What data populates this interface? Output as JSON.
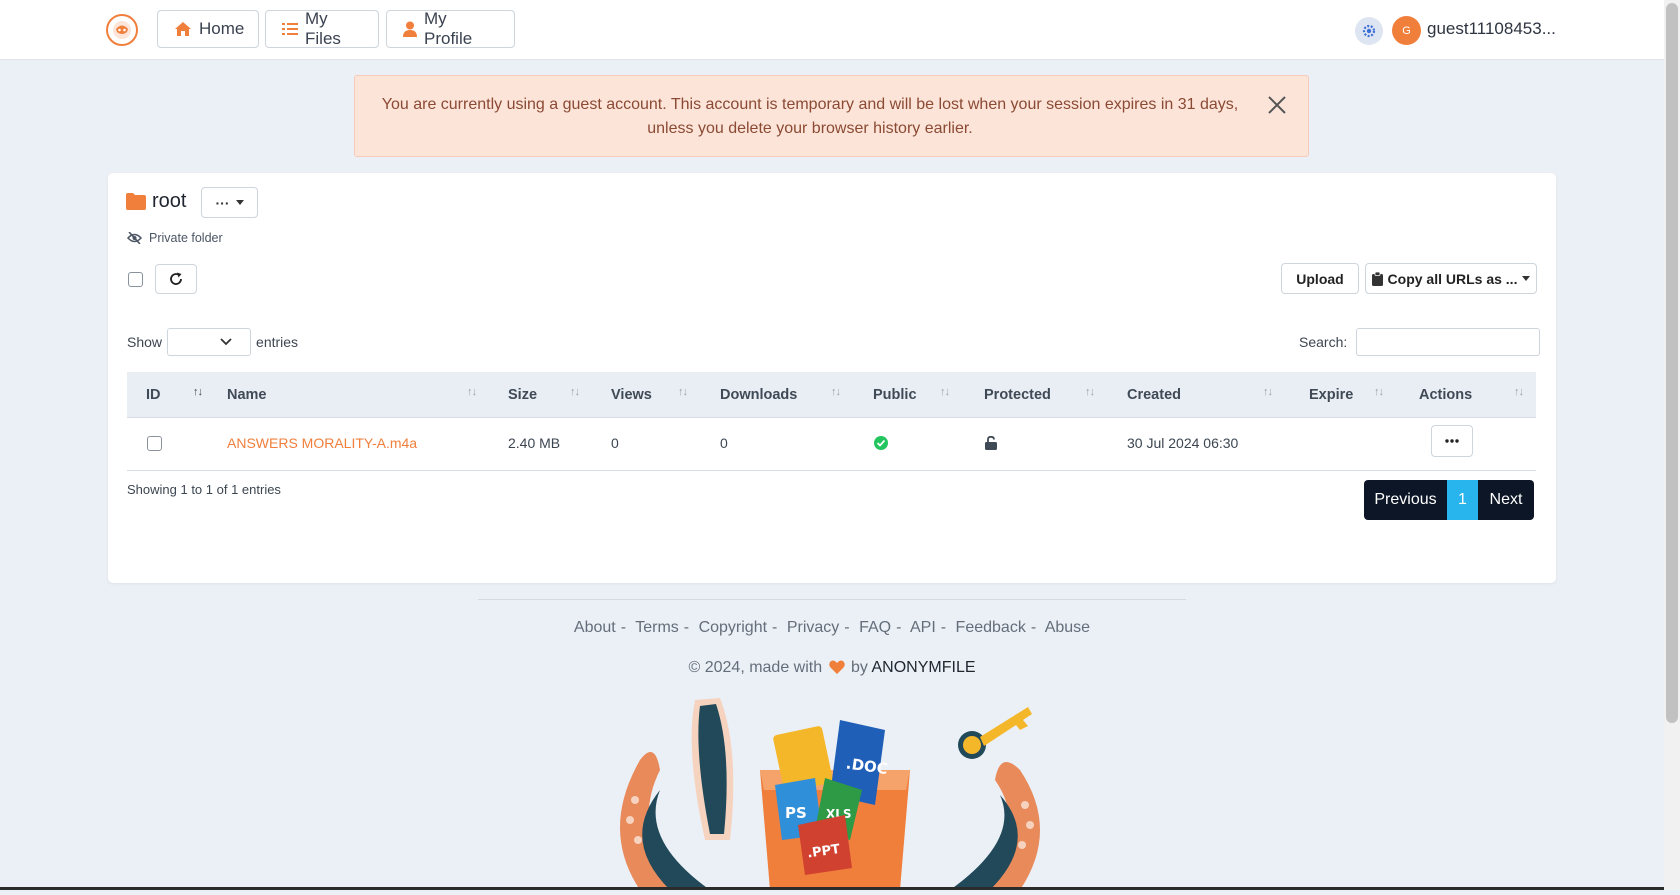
{
  "nav": {
    "home_label": "Home",
    "files_label": "My Files",
    "profile_label": "My Profile",
    "avatar_initial": "G",
    "username": "guest11108453..."
  },
  "alert": {
    "message": "You are currently using a guest account. This account is temporary and will be lost when your session expires in 31 days, unless you delete your browser history earlier."
  },
  "folder": {
    "name": "root",
    "menu_label": "···",
    "visibility": "Private folder"
  },
  "toolbar": {
    "upload_label": "Upload",
    "copy_label": "Copy all URLs as ..."
  },
  "table_controls": {
    "show_label": "Show",
    "entries_label": "entries",
    "search_label": "Search:",
    "search_value": ""
  },
  "table": {
    "columns": [
      "ID",
      "Name",
      "Size",
      "Views",
      "Downloads",
      "Public",
      "Protected",
      "Created",
      "Expire",
      "Actions"
    ],
    "rows": [
      {
        "name": "ANSWERS MORALITY-A.m4a",
        "size": "2.40 MB",
        "views": "0",
        "downloads": "0",
        "public": "check-circle-icon",
        "protected": "unlock-icon",
        "created": "30 Jul 2024 06:30",
        "expire": ""
      }
    ],
    "info": "Showing 1 to 1 of 1 entries"
  },
  "pagination": {
    "previous": "Previous",
    "current": "1",
    "next": "Next"
  },
  "footer": {
    "links": [
      "About",
      "Terms",
      "Copyright",
      "Privacy",
      "FAQ",
      "API",
      "Feedback",
      "Abuse"
    ],
    "made_prefix": "© 2024, made with",
    "made_by": "by",
    "brand": "ANONYMFILE"
  },
  "colors": {
    "accent": "#f07f3c",
    "pager_dark": "#0d1626",
    "pager_active": "#28b4ec",
    "public_green": "#22c55e",
    "alert_bg": "#fde4d9"
  }
}
